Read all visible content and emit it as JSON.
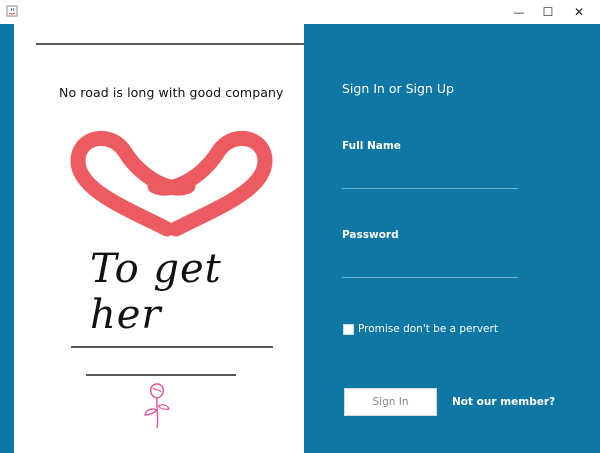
{
  "window": {
    "minimize_glyph": "—",
    "maximize_glyph": "☐",
    "close_glyph": "✕"
  },
  "left": {
    "quote": "No road is long with good company",
    "brand": "To get her"
  },
  "form": {
    "title": "Sign In or Sign Up",
    "fullname_label": "Full Name",
    "fullname_value": "",
    "password_label": "Password",
    "password_value": "",
    "checkbox_label": "Promise don't be a pervert",
    "checkbox_checked": false,
    "signin_label": "Sign In",
    "member_link": "Not our member?"
  },
  "colors": {
    "panel_blue": "#0e77a3",
    "heart_red": "#ec5b60",
    "rose_pink": "#e0549a"
  },
  "icons": [
    "java-app-icon",
    "minimize-icon",
    "maximize-icon",
    "close-icon",
    "hearts-logo-icon",
    "rose-icon"
  ]
}
